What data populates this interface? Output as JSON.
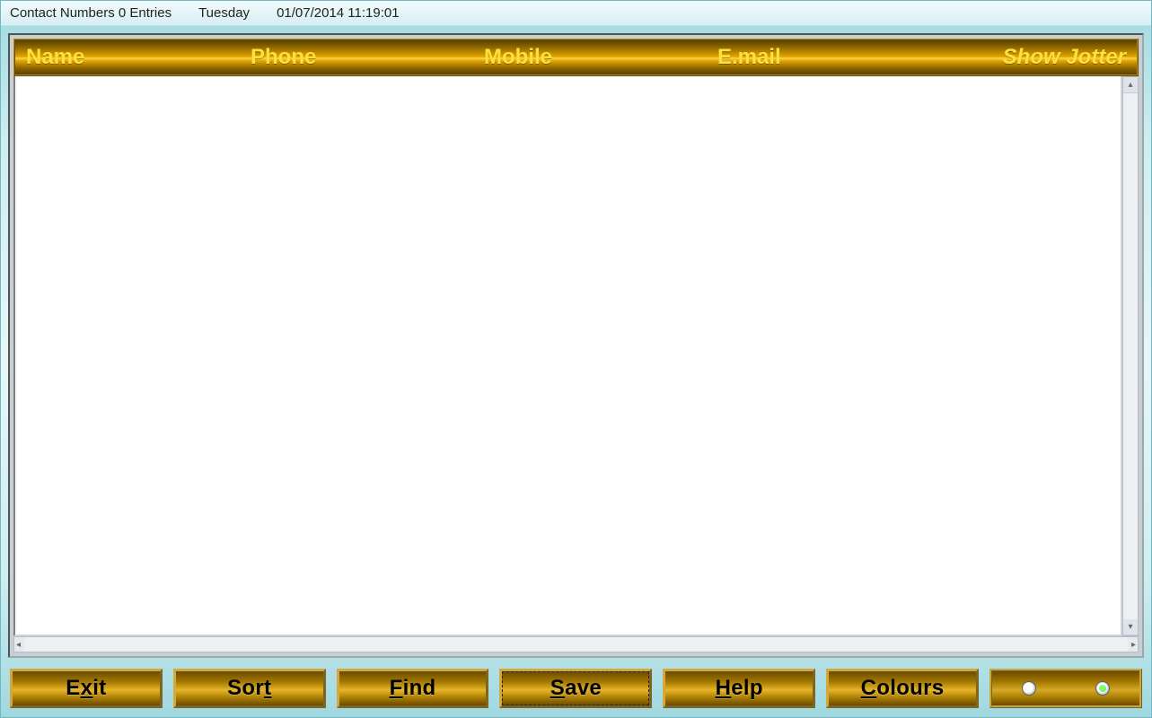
{
  "titlebar": {
    "title": "Contact Numbers 0 Entries",
    "day": "Tuesday",
    "datetime": "01/07/2014  11:19:01"
  },
  "columns": {
    "name": "Name",
    "phone": "Phone",
    "mobile": "Mobile",
    "email": "E.mail",
    "jotter": "Show Jotter"
  },
  "rows": [],
  "buttons": {
    "exit": {
      "label_pre": "E",
      "mnemonic": "x",
      "label_post": "it"
    },
    "sort": {
      "label_pre": "Sor",
      "mnemonic": "t",
      "label_post": ""
    },
    "find": {
      "label_pre": "",
      "mnemonic": "F",
      "label_post": "ind"
    },
    "save": {
      "label_pre": "",
      "mnemonic": "S",
      "label_post": "ave"
    },
    "help": {
      "label_pre": "",
      "mnemonic": "H",
      "label_post": "elp"
    },
    "colours": {
      "label_pre": "",
      "mnemonic": "C",
      "label_post": "olours"
    }
  },
  "radios": {
    "a_checked": false,
    "b_checked": true
  },
  "colors": {
    "gold_header_from": "#5a4100",
    "gold_header_to": "#ffd24d",
    "accent_text": "#ffe03a"
  }
}
